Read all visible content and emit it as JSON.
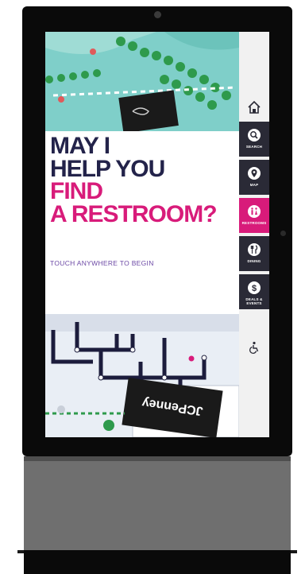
{
  "headline": {
    "line1": "MAY I",
    "line2": "HELP YOU",
    "line3": "FIND",
    "line4": "A RESTROOM?"
  },
  "prompt": "TOUCH ANYWHERE TO BEGIN",
  "map": {
    "store_label": "JCPenney"
  },
  "sidebar": {
    "items": [
      {
        "label": "SEARCH",
        "icon": "search-icon"
      },
      {
        "label": "MAP",
        "icon": "map-pin-icon"
      },
      {
        "label": "RESTROOMS",
        "icon": "restroom-icon",
        "active": true
      },
      {
        "label": "DINING",
        "icon": "dining-icon"
      },
      {
        "label": "DEALS & EVENTS",
        "icon": "deals-icon"
      }
    ]
  },
  "colors": {
    "accent": "#d81b7a",
    "dark_text": "#23234a",
    "nav_bg": "#2a2a36",
    "map_green": "#2e9a4c",
    "map_teal": "#7fcfc9"
  }
}
